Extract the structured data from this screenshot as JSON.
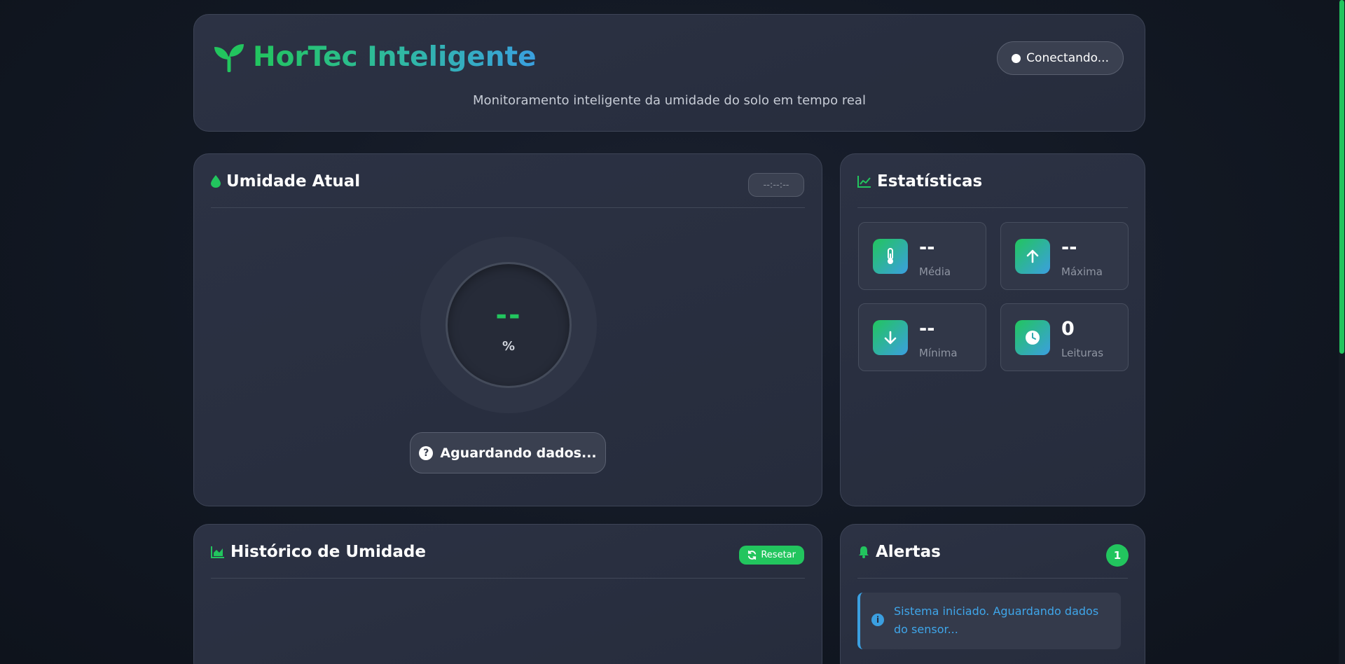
{
  "header": {
    "title": "HorTec Inteligente",
    "subtitle": "Monitoramento inteligente da umidade do solo em tempo real",
    "status": "Conectando..."
  },
  "humidity": {
    "title": "Umidade Atual",
    "time": "--:--:--",
    "value": "--",
    "unit": "%",
    "state": "Aguardando dados..."
  },
  "stats": {
    "title": "Estatísticas",
    "items": [
      {
        "value": "--",
        "label": "Média",
        "icon": "thermometer-icon"
      },
      {
        "value": "--",
        "label": "Máxima",
        "icon": "arrow-up-icon"
      },
      {
        "value": "--",
        "label": "Mínima",
        "icon": "arrow-down-icon"
      },
      {
        "value": "0",
        "label": "Leituras",
        "icon": "clock-icon"
      }
    ]
  },
  "history": {
    "title": "Histórico de Umidade",
    "reset_label": "Resetar"
  },
  "alerts": {
    "title": "Alertas",
    "count": "1",
    "items": [
      {
        "text": "Sistema iniciado. Aguardando dados do sensor..."
      }
    ]
  },
  "colors": {
    "accent": "#22c55e",
    "info": "#3b9fe0",
    "card": "#2a3042"
  }
}
